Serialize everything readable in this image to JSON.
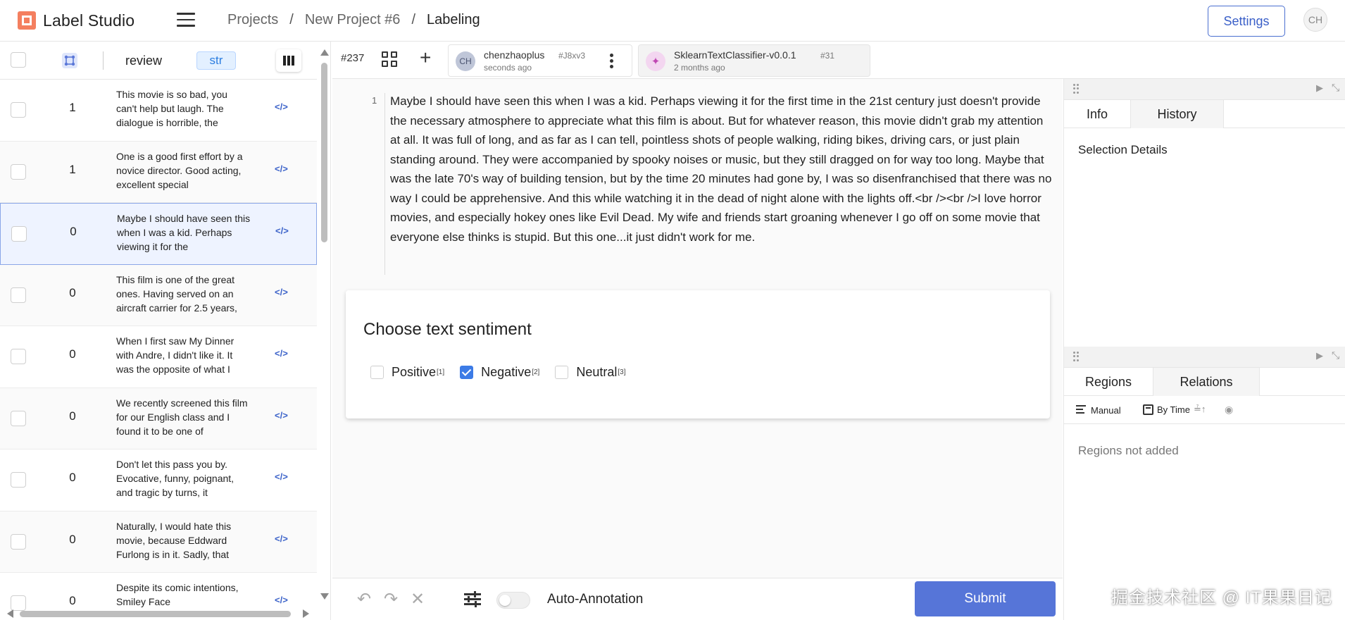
{
  "app": {
    "name": "Label Studio"
  },
  "breadcrumb": {
    "projects": "Projects",
    "project": "New Project #6",
    "page": "Labeling",
    "separator": "/"
  },
  "header": {
    "settings_label": "Settings",
    "user_initials": "CH"
  },
  "data_manager": {
    "columns": {
      "review": "review",
      "type_badge": "str"
    },
    "rows": [
      {
        "id": "1",
        "text": "This movie is so bad, you can't help but laugh. The dialogue is horrible, the"
      },
      {
        "id": "1",
        "text": "One is a good first effort by a novice director. Good acting, excellent special"
      },
      {
        "id": "0",
        "text": "Maybe I should have seen this when I was a kid. Perhaps viewing it for the"
      },
      {
        "id": "0",
        "text": "This film is one of the great ones. Having served on an aircraft carrier for 2.5 years,"
      },
      {
        "id": "0",
        "text": "When I first saw My Dinner with Andre, I didn't like it. It was the opposite of what I"
      },
      {
        "id": "0",
        "text": "We recently screened this film for our English class and I found it to be one of"
      },
      {
        "id": "0",
        "text": "Don't let this pass you by. Evocative, funny, poignant, and tragic by turns, it"
      },
      {
        "id": "0",
        "text": "Naturally, I would hate this movie, because Eddward Furlong is in it. Sadly, that"
      },
      {
        "id": "0",
        "text": "Despite its comic intentions, Smiley Face"
      }
    ],
    "code_glyph": "</>"
  },
  "annotation_bar": {
    "task_id": "#237",
    "tabs": [
      {
        "initials": "CH",
        "user": "chenzhaoplus",
        "id": "#J8xv3",
        "time": "seconds ago"
      },
      {
        "initials": "✦",
        "user": "SklearnTextClassifier-v0.0.1",
        "id": "#31",
        "time": "2 months ago"
      }
    ]
  },
  "task": {
    "line_number": "1",
    "text": "Maybe I should have seen this when I was a kid. Perhaps viewing it for the first time in the 21st century just doesn't provide the necessary atmosphere to appreciate what this film is about. But for whatever reason, this movie didn't grab my attention at all. It was full of long, and as far as I can tell, pointless shots of people walking, riding bikes, driving cars, or just plain standing around. They were accompanied by spooky noises or music, but they still dragged on for way too long. Maybe that was the late 70's way of building tension, but by the time 20 minutes had gone by, I was so disenfranchised that there was no way I could be apprehensive. And this while watching it in the dead of night alone with the lights off.<br /><br />I love horror movies, and especially hokey ones like Evil Dead. My wife and friends start groaning whenever I go off on some movie that everyone else thinks is stupid. But this one...it just didn't work for me."
  },
  "sentiment": {
    "title": "Choose text sentiment",
    "choices": [
      {
        "label": "Positive",
        "hotkey": "[1]",
        "checked": false
      },
      {
        "label": "Negative",
        "hotkey": "[2]",
        "checked": true
      },
      {
        "label": "Neutral",
        "hotkey": "[3]",
        "checked": false
      }
    ]
  },
  "bottom_bar": {
    "auto_annotation_label": "Auto-Annotation",
    "auto_annotation_enabled": false,
    "submit_label": "Submit"
  },
  "sidebar": {
    "info_tab": "Info",
    "history_tab": "History",
    "selection_details": "Selection Details",
    "regions_tab": "Regions",
    "relations_tab": "Relations",
    "manual_label": "Manual",
    "by_time_label": "By Time",
    "regions_empty": "Regions not added"
  },
  "watermark": "掘金技术社区 @ IT果果日记",
  "colors": {
    "primary": "#5675d8",
    "checked": "#3c7be6"
  }
}
